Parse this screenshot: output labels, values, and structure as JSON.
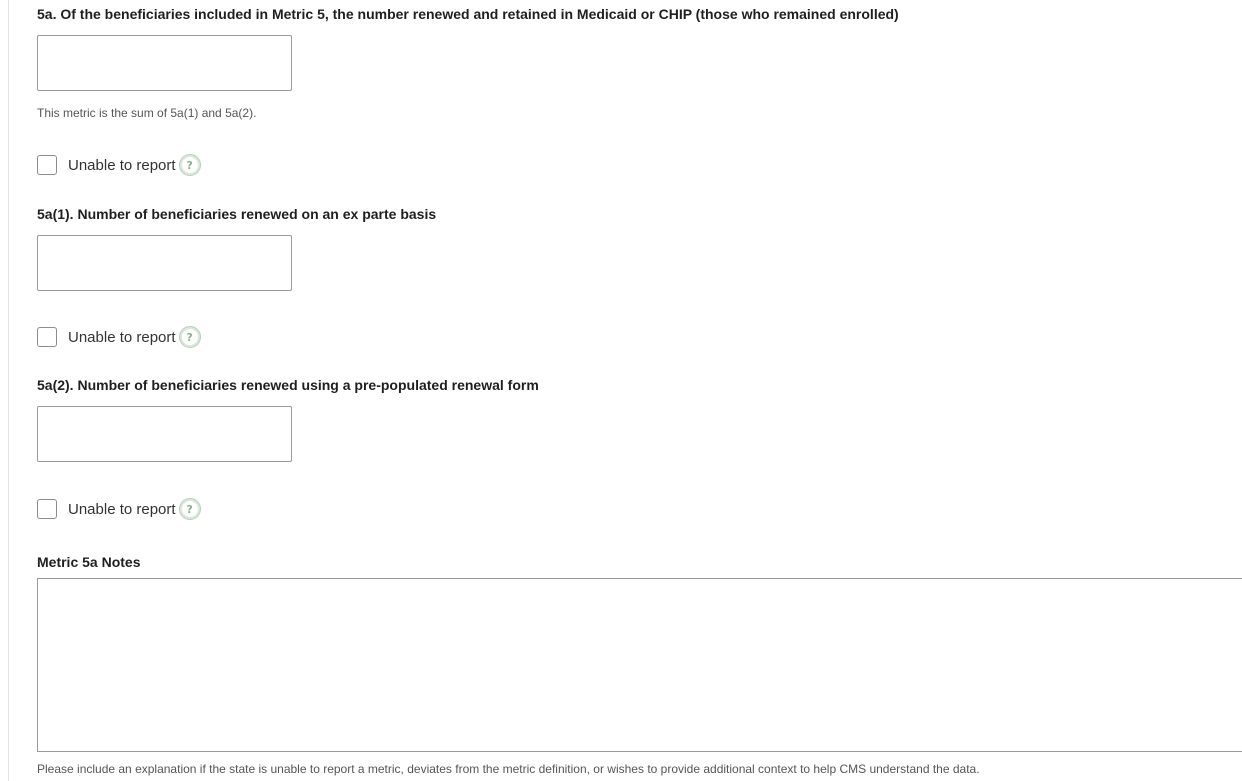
{
  "metric5a": {
    "label": "5a. Of the beneficiaries included in Metric 5, the number renewed and retained in Medicaid or CHIP (those who remained enrolled)",
    "value": "",
    "hint": "This metric is the sum of 5a(1) and 5a(2).",
    "unable_label": "Unable to report",
    "unable_checked": false,
    "help_icon": "question-circle-icon"
  },
  "metric5a1": {
    "label": "5a(1). Number of beneficiaries renewed on an ex parte basis",
    "value": "",
    "unable_label": "Unable to report",
    "unable_checked": false,
    "help_icon": "question-circle-icon"
  },
  "metric5a2": {
    "label": "5a(2). Number of beneficiaries renewed using a pre-populated renewal form",
    "value": "",
    "unable_label": "Unable to report",
    "unable_checked": false,
    "help_icon": "question-circle-icon"
  },
  "notes": {
    "label": "Metric 5a Notes",
    "value": "",
    "hint": "Please include an explanation if the state is unable to report a metric, deviates from the metric definition, or wishes to provide additional context to help CMS understand the data."
  },
  "help_glyph": "?"
}
